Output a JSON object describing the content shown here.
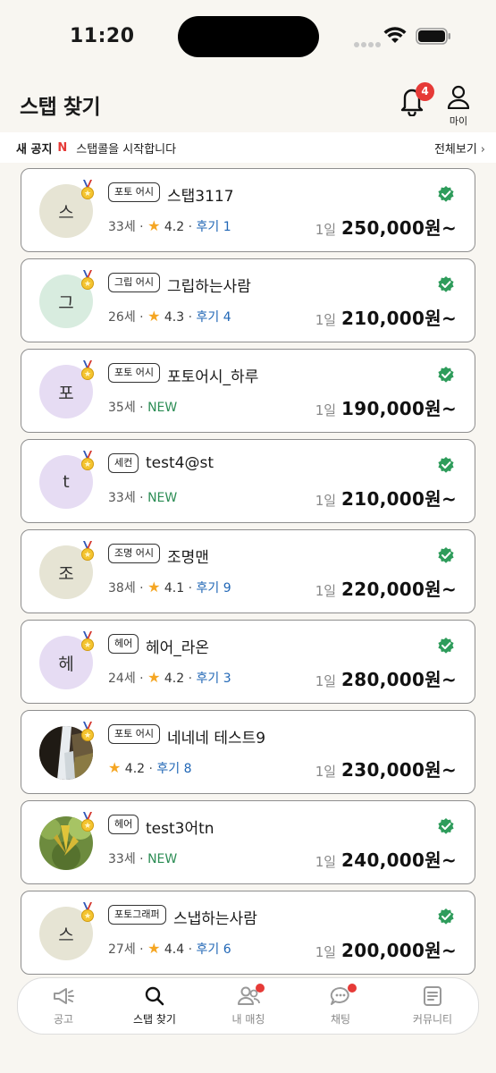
{
  "status": {
    "time": "11:20"
  },
  "header": {
    "title": "스탭 찾기",
    "notification_count": "4",
    "my_label": "마이"
  },
  "notice": {
    "new_label": "새 공지",
    "n_badge": "N",
    "text": "스탭콜을 시작합니다",
    "view_all": "전체보기"
  },
  "cards": [
    {
      "avatar_char": "스",
      "avatar_bg": "#e6e4d4",
      "tag": "포토 어시",
      "name": "스탭3117",
      "age": "33세",
      "rating": "4.2",
      "reviews": "후기 1",
      "new": "",
      "verified": true,
      "day": "1일",
      "price": "250,000원~"
    },
    {
      "avatar_char": "그",
      "avatar_bg": "#d8ecdf",
      "tag": "그립 어시",
      "name": "그립하는사람",
      "age": "26세",
      "rating": "4.3",
      "reviews": "후기 4",
      "new": "",
      "verified": true,
      "day": "1일",
      "price": "210,000원~"
    },
    {
      "avatar_char": "포",
      "avatar_bg": "#e6dcf3",
      "tag": "포토 어시",
      "name": "포토어시_하루",
      "age": "35세",
      "rating": "",
      "reviews": "",
      "new": "NEW",
      "verified": true,
      "day": "1일",
      "price": "190,000원~"
    },
    {
      "avatar_char": "t",
      "avatar_bg": "#e6dcf3",
      "tag": "세컨",
      "name": "test4@st",
      "age": "33세",
      "rating": "",
      "reviews": "",
      "new": "NEW",
      "verified": true,
      "day": "1일",
      "price": "210,000원~"
    },
    {
      "avatar_char": "조",
      "avatar_bg": "#e6e4d4",
      "tag": "조명 어시",
      "name": "조명맨",
      "age": "38세",
      "rating": "4.1",
      "reviews": "후기 9",
      "new": "",
      "verified": true,
      "day": "1일",
      "price": "220,000원~"
    },
    {
      "avatar_char": "헤",
      "avatar_bg": "#e6dcf3",
      "tag": "헤어",
      "name": "헤어_라온",
      "age": "24세",
      "rating": "4.2",
      "reviews": "후기 3",
      "new": "",
      "verified": true,
      "day": "1일",
      "price": "280,000원~"
    },
    {
      "avatar_char": "",
      "avatar_bg": "photo-waterfall",
      "tag": "포토 어시",
      "name": "네네네 테스트9",
      "age": "",
      "rating": "4.2",
      "reviews": "후기 8",
      "new": "",
      "verified": false,
      "day": "1일",
      "price": "230,000원~"
    },
    {
      "avatar_char": "",
      "avatar_bg": "photo-plant",
      "tag": "헤어",
      "name": "test3어tn",
      "age": "33세",
      "rating": "",
      "reviews": "",
      "new": "NEW",
      "verified": true,
      "day": "1일",
      "price": "240,000원~"
    },
    {
      "avatar_char": "스",
      "avatar_bg": "#e6e4d4",
      "tag": "포토그래퍼",
      "name": "스냅하는사람",
      "age": "27세",
      "rating": "4.4",
      "reviews": "후기 6",
      "new": "",
      "verified": true,
      "day": "1일",
      "price": "200,000원~"
    }
  ],
  "tabs": [
    {
      "label": "공고",
      "icon": "megaphone-icon",
      "active": false,
      "dot": false
    },
    {
      "label": "스탭 찾기",
      "icon": "search-icon",
      "active": true,
      "dot": false
    },
    {
      "label": "내 매칭",
      "icon": "people-icon",
      "active": false,
      "dot": true
    },
    {
      "label": "채팅",
      "icon": "chat-icon",
      "active": false,
      "dot": true
    },
    {
      "label": "커뮤니티",
      "icon": "board-icon",
      "active": false,
      "dot": false
    }
  ],
  "colors": {
    "accent_red": "#e63a37",
    "verified_green": "#2e9c5b",
    "review_blue": "#2167b6",
    "star": "#f5a623"
  }
}
